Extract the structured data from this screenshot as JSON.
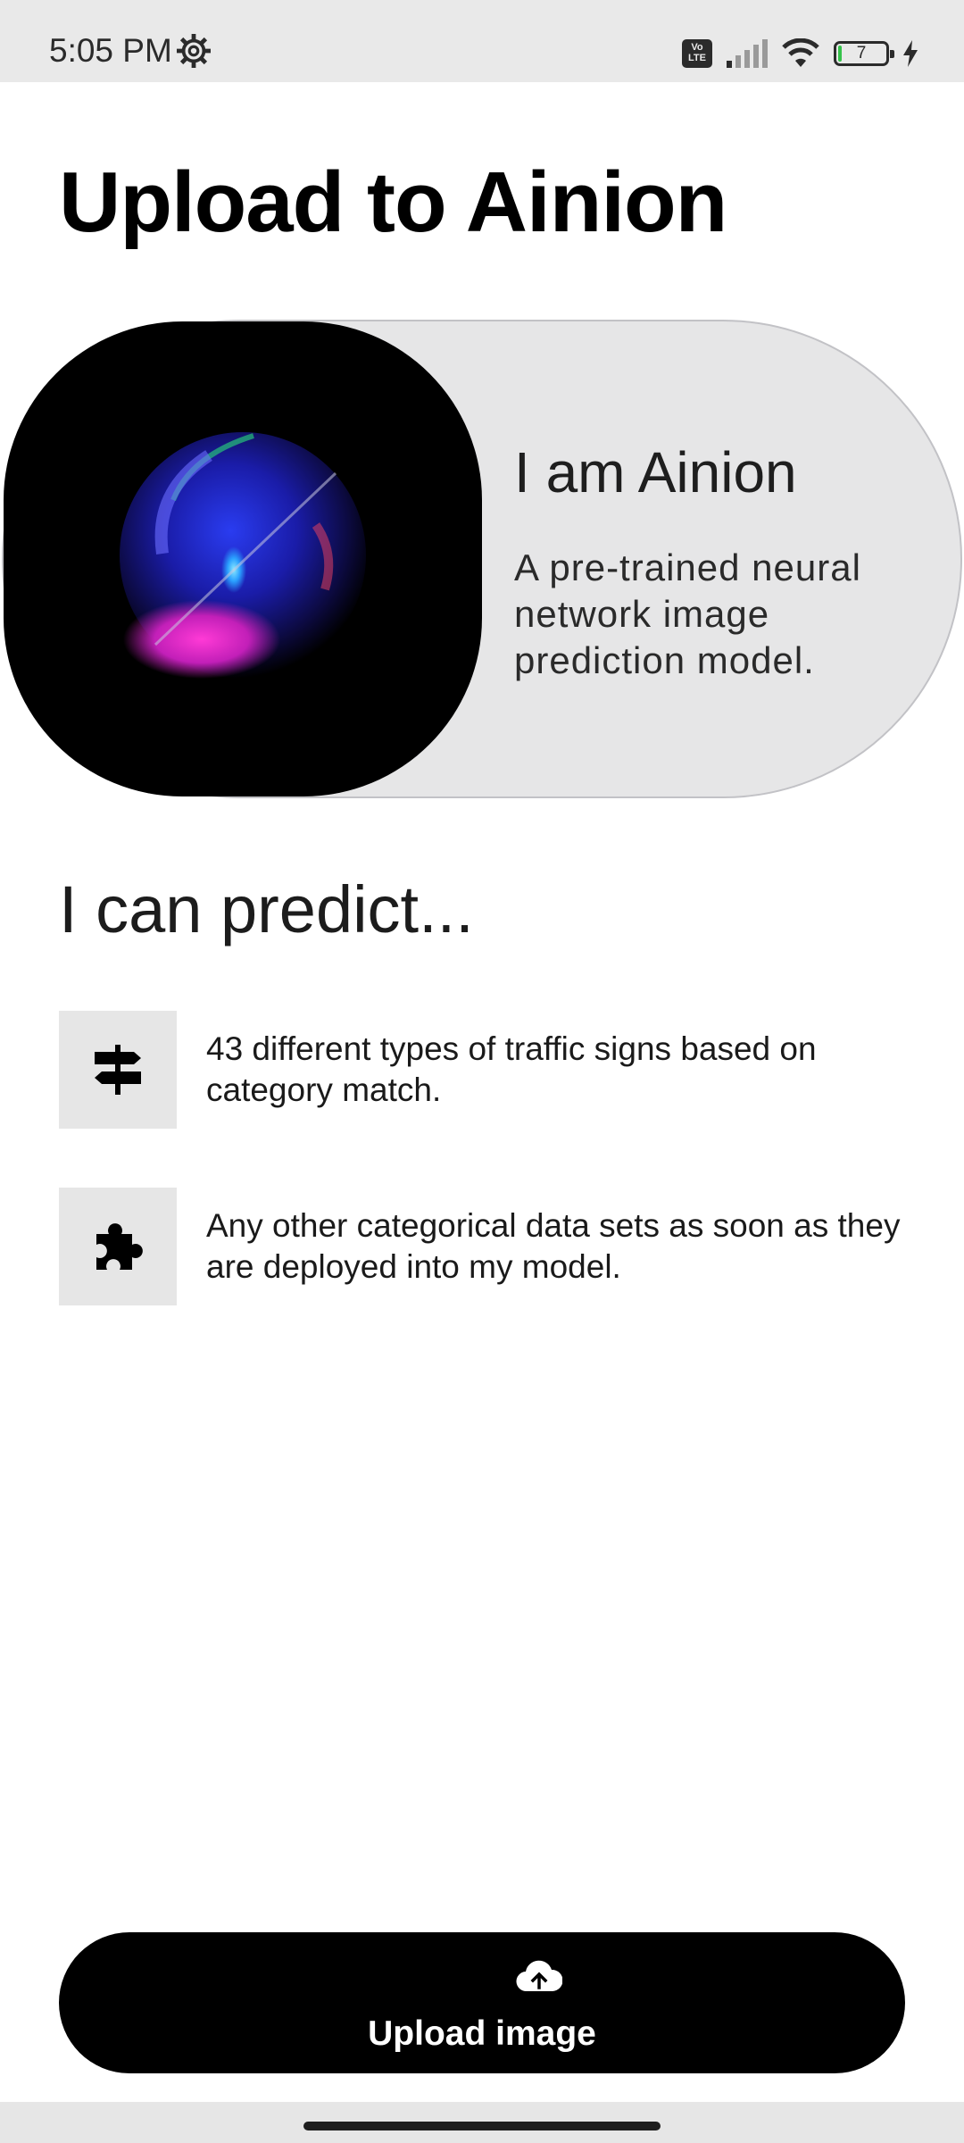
{
  "status_bar": {
    "time": "5:05 PM",
    "volte_label": "Vo LTE",
    "battery_level": "7",
    "battery_fraction": 0.07,
    "battery_color": "#35c24a",
    "icons": [
      "gear-icon",
      "volte-icon",
      "signal-icon",
      "wifi-icon",
      "battery-icon",
      "charging-icon"
    ]
  },
  "header": {
    "title": "Upload to Ainion"
  },
  "ainion_card": {
    "name": "I am Ainion",
    "description": "A pre-trained neural network image prediction model."
  },
  "predict_section": {
    "heading": "I can predict...",
    "items": [
      {
        "icon": "signpost-icon",
        "text": "43 different types of traffic signs based on category match."
      },
      {
        "icon": "puzzle-icon",
        "text": "Any other categorical data sets as soon as they are deployed into my model."
      }
    ]
  },
  "upload_button": {
    "icon": "cloud-upload-icon",
    "label": "Upload image"
  },
  "colors": {
    "accent": "#000000",
    "card_background": "#e6e6e7",
    "status_bar_background": "#e9e9e9"
  }
}
